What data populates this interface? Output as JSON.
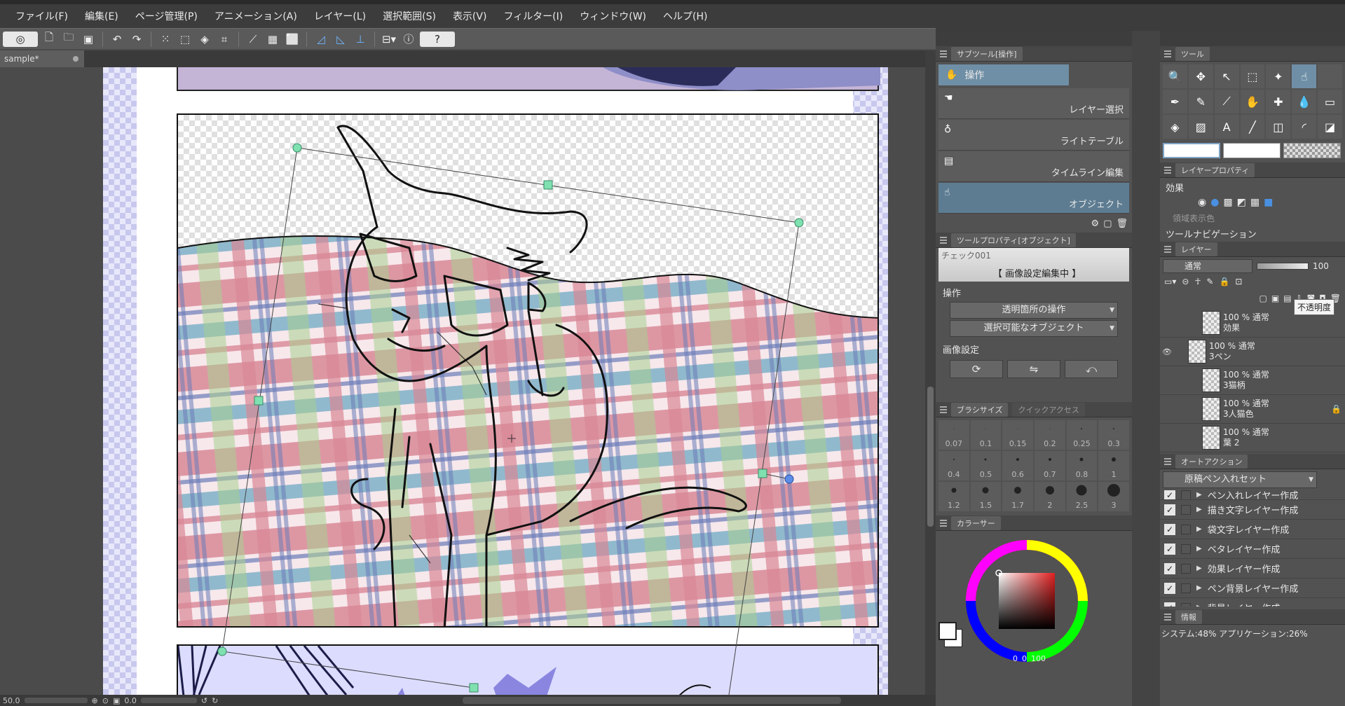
{
  "menu": [
    "ファイル(F)",
    "編集(E)",
    "ページ管理(P)",
    "アニメーション(A)",
    "レイヤー(L)",
    "選択範囲(S)",
    "表示(V)",
    "フィルター(I)",
    "ウィンドウ(W)",
    "ヘルプ(H)"
  ],
  "document_tab": "sample*",
  "status": {
    "zoom": "50.0",
    "angle": "0.0"
  },
  "subtool": {
    "tab": "サブツール[操作]",
    "top_item": "操作",
    "items": [
      "レイヤー選択",
      "ライトテーブル",
      "タイムライン編集",
      "オブジェクト"
    ]
  },
  "tool_property": {
    "tab": "ツールプロパティ[オブジェクト]",
    "banner_name": "チェック001",
    "banner_status": "【 画像設定編集中 】",
    "section_op": "操作",
    "dropdown1": "透明箇所の操作",
    "dropdown2": "選択可能なオブジェクト",
    "section_image": "画像設定"
  },
  "brush": {
    "tab": "ブラシサイズ",
    "tab2": "クイックアクセス",
    "sizes": [
      "0.07",
      "0.1",
      "0.15",
      "0.2",
      "0.25",
      "0.3",
      "0.4",
      "0.5",
      "0.6",
      "0.7",
      "0.8",
      "1",
      "1.2",
      "1.5",
      "1.7",
      "2",
      "2.5",
      "3"
    ]
  },
  "color": {
    "tab": "カラーサー",
    "value_readout": "100",
    "h": "0",
    "s": "0"
  },
  "tool_panel": {
    "tab": "ツール"
  },
  "layer_property": {
    "tab": "レイヤープロパティ",
    "effect_label": "効果",
    "area_color_label": "領域表示色",
    "tool_nav": "ツールナビゲーション"
  },
  "layer_panel": {
    "tab": "レイヤー",
    "blend": "通常",
    "opacity": "100",
    "tooltip": "不透明度",
    "layers": [
      {
        "top": "100 % 通常",
        "name": "効果"
      },
      {
        "top": "100 % 通常",
        "name": "3ペン"
      },
      {
        "top": "100 % 通常",
        "name": "3猫柄"
      },
      {
        "top": "100 % 通常",
        "name": "3人猫色"
      },
      {
        "top": "100 % 通常",
        "name": "葉 2"
      }
    ]
  },
  "auto_action": {
    "tab": "オートアクション",
    "set": "原稿ペン入れセット",
    "items": [
      "ペン入れレイヤー作成",
      "描き文字レイヤー作成",
      "袋文字レイヤー作成",
      "ベタレイヤー作成",
      "効果レイヤー作成",
      "ペン背景レイヤー作成",
      "背景レイヤー作成"
    ]
  },
  "info": {
    "tab": "情報",
    "text": "システム:48% アプリケーション:26%"
  }
}
